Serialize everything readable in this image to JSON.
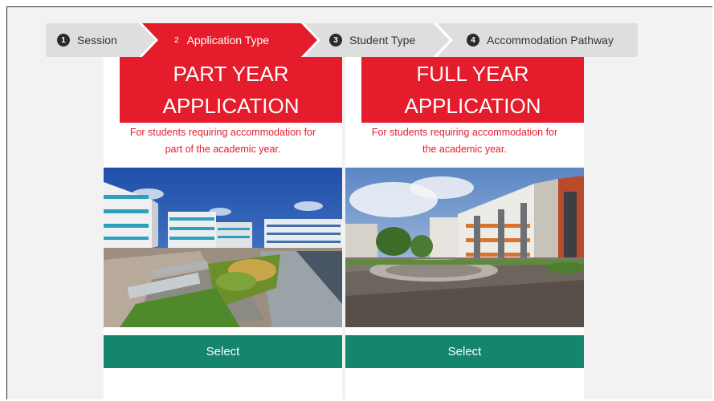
{
  "stepper": {
    "steps": [
      {
        "num": "1",
        "label": "Session",
        "state": "done"
      },
      {
        "num": "2",
        "label": "Application Type",
        "state": "active"
      },
      {
        "num": "3",
        "label": "Student Type",
        "state": "pending"
      },
      {
        "num": "4",
        "label": "Accommodation Pathway",
        "state": "pending"
      }
    ]
  },
  "cards": [
    {
      "title_line1": "PART YEAR",
      "title_line2": "APPLICATION",
      "desc_line1": "For students requiring accommodation for",
      "desc_line2": "part of the academic year.",
      "select_label": "Select"
    },
    {
      "title_line1": "FULL YEAR",
      "title_line2": "APPLICATION",
      "desc_line1": "For students requiring accommodation for",
      "desc_line2": "the academic year.",
      "select_label": "Select"
    }
  ],
  "colors": {
    "accent_red": "#e51c2b",
    "select_green": "#14866d",
    "stepper_gray": "#dedede"
  }
}
